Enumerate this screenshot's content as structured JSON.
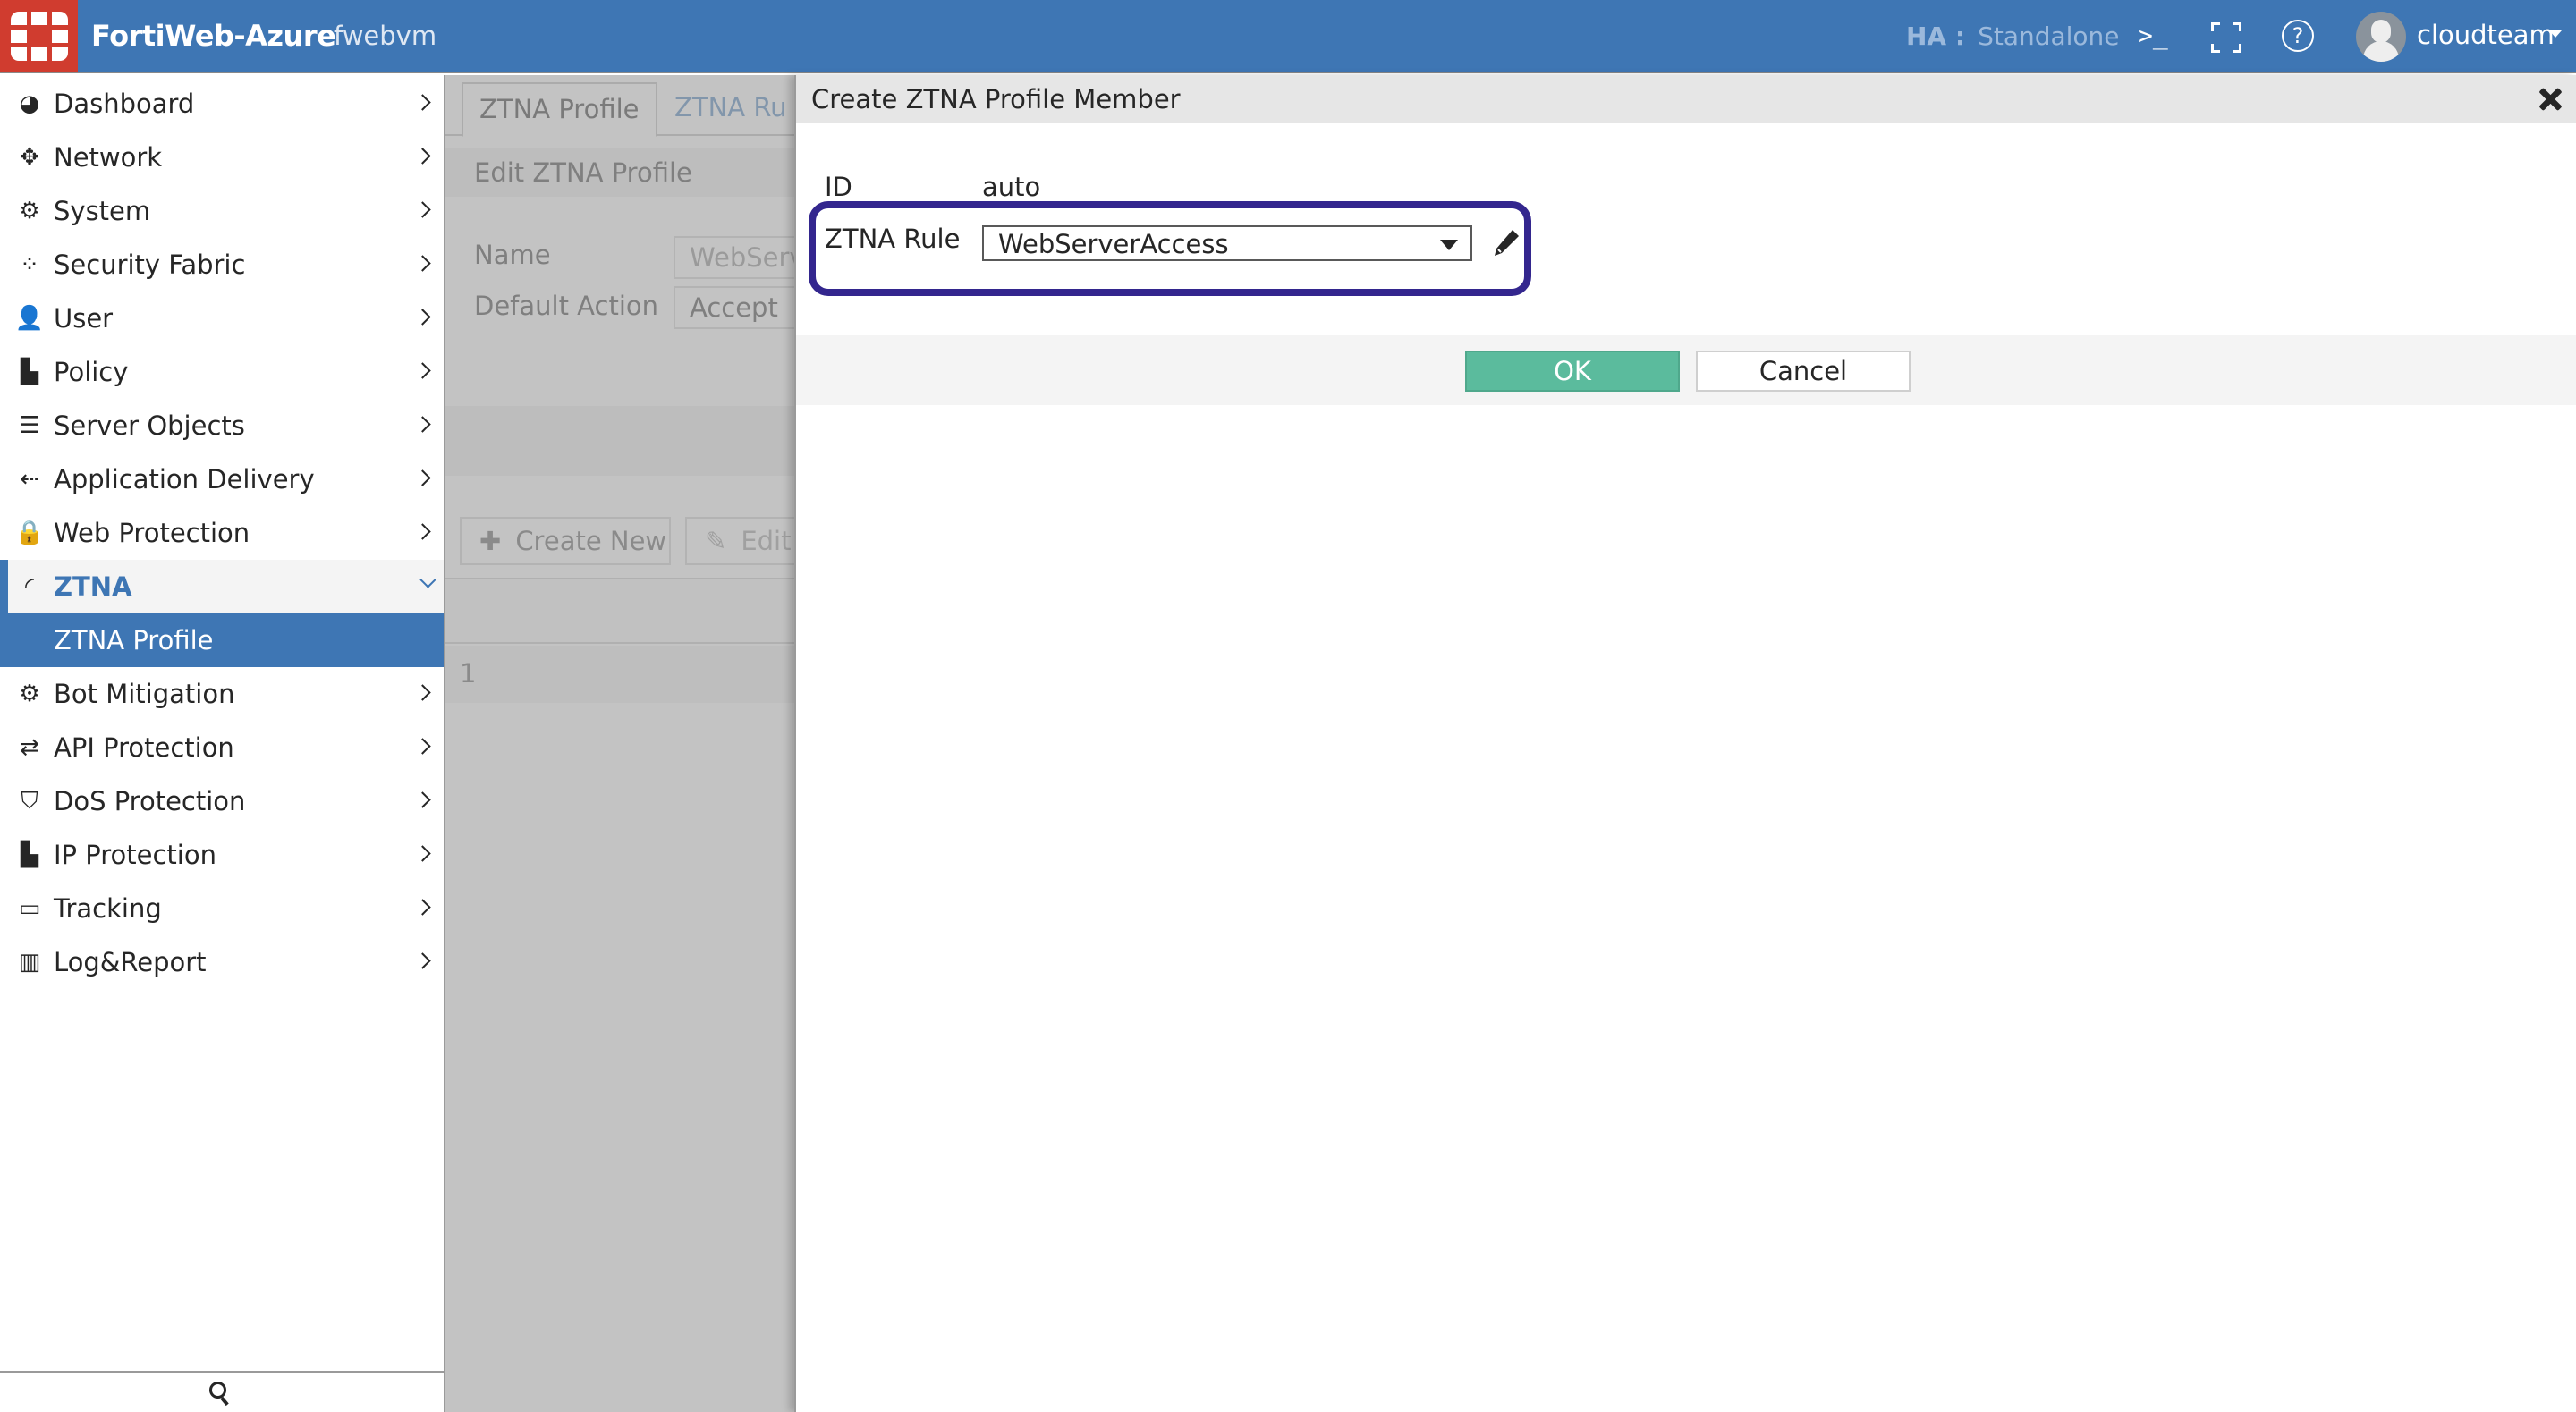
{
  "header": {
    "app_title": "FortiWeb-Azure",
    "host_name": "fwebvm",
    "ha_label": "HA :",
    "ha_value": "Standalone",
    "cli_icon": ">_",
    "help_icon": "?",
    "user_name": "cloudteam",
    "colors": {
      "header_bg": "#3e76b4",
      "logo_bg": "#d03c2f"
    }
  },
  "sidebar": {
    "items": [
      {
        "label": "Dashboard",
        "icon": "dashboard-icon",
        "glyph": "◕"
      },
      {
        "label": "Network",
        "icon": "move-arrows-icon",
        "glyph": "✥"
      },
      {
        "label": "System",
        "icon": "gear-icon",
        "glyph": "⚙"
      },
      {
        "label": "Security Fabric",
        "icon": "fabric-icon",
        "glyph": "⁘"
      },
      {
        "label": "User",
        "icon": "user-icon",
        "glyph": "👤"
      },
      {
        "label": "Policy",
        "icon": "policy-icon",
        "glyph": "▙"
      },
      {
        "label": "Server Objects",
        "icon": "server-icon",
        "glyph": "☰"
      },
      {
        "label": "Application Delivery",
        "icon": "delivery-icon",
        "glyph": "⇠"
      },
      {
        "label": "Web Protection",
        "icon": "lock-icon",
        "glyph": "🔒"
      },
      {
        "label": "ZTNA",
        "icon": "fingerprint-icon",
        "glyph": "◜"
      },
      {
        "label": "ZTNA Profile"
      },
      {
        "label": "Bot Mitigation",
        "icon": "gears-icon",
        "glyph": "⚙"
      },
      {
        "label": "API Protection",
        "icon": "exchange-icon",
        "glyph": "⇄"
      },
      {
        "label": "DoS Protection",
        "icon": "shield-icon",
        "glyph": "⛉"
      },
      {
        "label": "IP Protection",
        "icon": "ip-policy-icon",
        "glyph": "▙"
      },
      {
        "label": "Tracking",
        "icon": "laptop-icon",
        "glyph": "▭"
      },
      {
        "label": "Log&Report",
        "icon": "bar-chart-icon",
        "glyph": "▥"
      }
    ],
    "active_group": "ZTNA",
    "active_item": "ZTNA Profile"
  },
  "background": {
    "tabs": [
      "ZTNA Profile",
      "ZTNA Ru"
    ],
    "edit_title": "Edit ZTNA Profile",
    "name_label": "Name",
    "name_value": "WebServ",
    "default_action_label": "Default Action",
    "default_action_value": "Accept",
    "create_new_label": "Create New",
    "edit_label": "Edit",
    "row_id": "1"
  },
  "dialog": {
    "title": "Create ZTNA Profile Member",
    "id_label": "ID",
    "id_value": "auto",
    "rule_label": "ZTNA Rule",
    "rule_value": "WebServerAccess",
    "ok_label": "OK",
    "cancel_label": "Cancel",
    "colors": {
      "ok_bg": "#5bbb9d",
      "highlight": "#33268e"
    }
  }
}
